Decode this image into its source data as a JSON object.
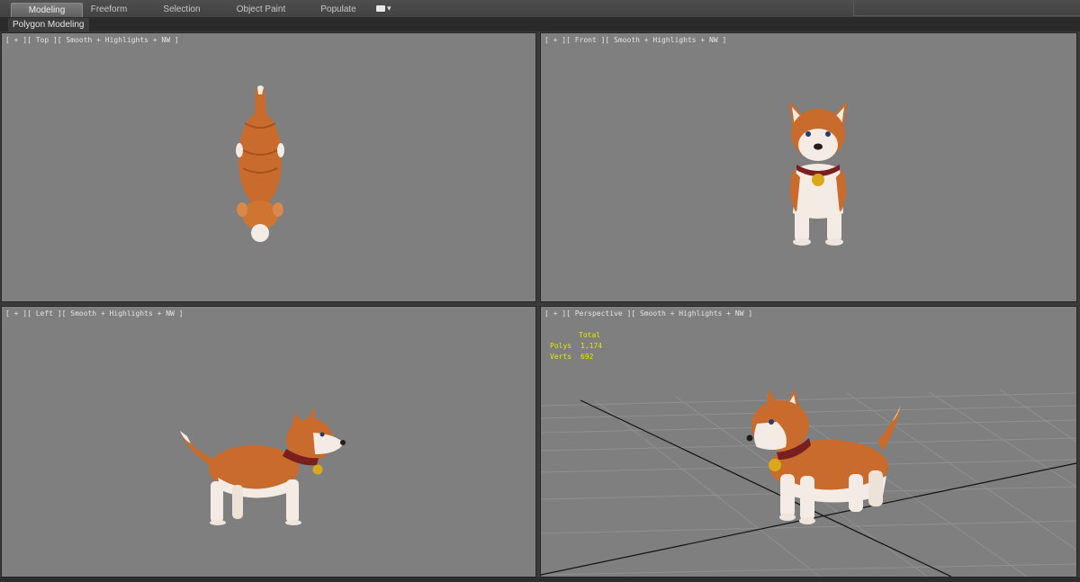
{
  "ribbon": {
    "tabs": [
      {
        "label": "Modeling",
        "active": true
      },
      {
        "label": "Freeform",
        "active": false
      },
      {
        "label": "Selection",
        "active": false
      },
      {
        "label": "Object Paint",
        "active": false
      },
      {
        "label": "Populate",
        "active": false
      }
    ],
    "dropdown_icon": "ribbon-options-icon"
  },
  "subpanel": {
    "label": "Polygon Modeling"
  },
  "viewports": {
    "top": {
      "label": "[ + ][ Top ][ Smooth + Highlights + NW ]"
    },
    "front": {
      "label": "[ + ][ Front ][ Smooth + Highlights + NW ]"
    },
    "left": {
      "label": "[ + ][ Left ][ Smooth + Highlights + NW ]"
    },
    "perspective": {
      "label": "[ + ][ Perspective ][ Smooth + Highlights + NW ]",
      "stats": {
        "header": "Total",
        "polys_label": "Polys",
        "polys_value": "1,174",
        "verts_label": "Verts",
        "verts_value": "692"
      }
    }
  },
  "colors": {
    "viewport_bg": "#7f7f7f",
    "stats_text": "#e6e600",
    "fur_orange": "#c96b2c",
    "fur_white": "#f4ece4",
    "collar": "#7a1f1f",
    "bell": "#d9a81c"
  }
}
